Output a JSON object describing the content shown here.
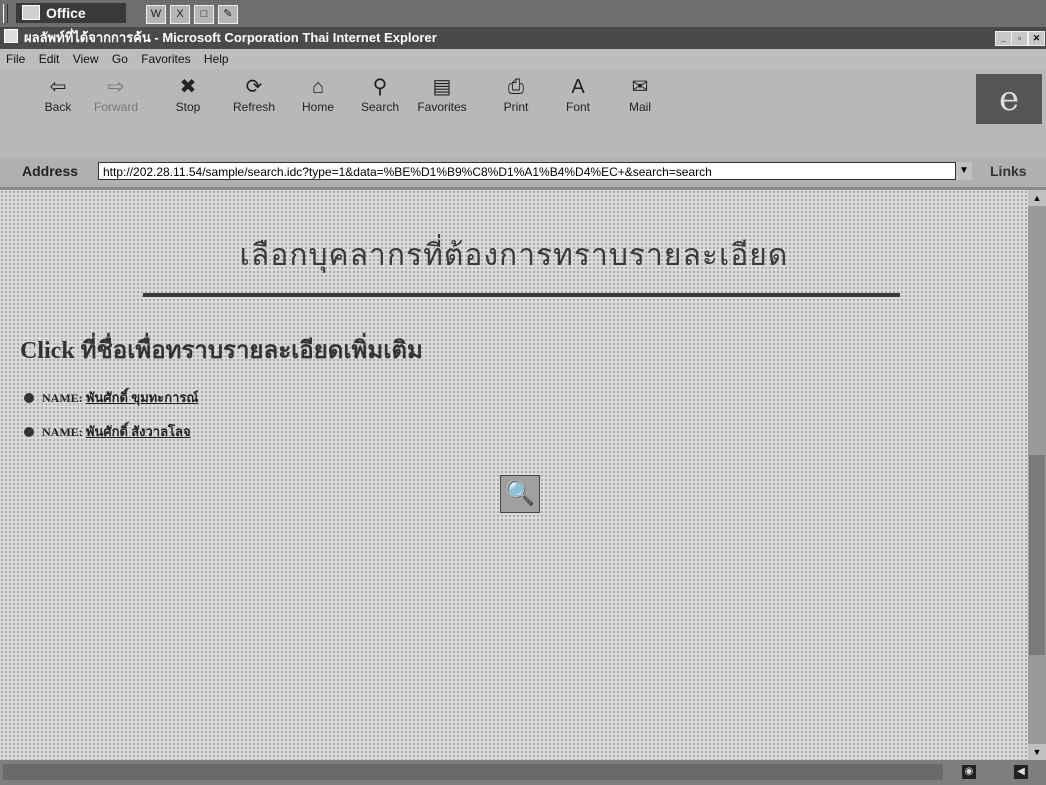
{
  "office_bar": {
    "label": "Office",
    "apps": [
      {
        "icon": "word-icon",
        "glyph": "W"
      },
      {
        "icon": "excel-icon",
        "glyph": "X"
      },
      {
        "icon": "powerpoint-icon",
        "glyph": "□"
      },
      {
        "icon": "access-icon",
        "glyph": "✎"
      }
    ]
  },
  "window": {
    "title": "ผลลัพท์ที่ได้จากการค้น - Microsoft Corporation Thai Internet Explorer"
  },
  "menu": [
    "File",
    "Edit",
    "View",
    "Go",
    "Favorites",
    "Help"
  ],
  "toolbar": {
    "buttons": [
      {
        "label": "Back",
        "icon": "back-arrow-icon",
        "glyph": "⇦"
      },
      {
        "label": "Forward",
        "icon": "forward-arrow-icon",
        "glyph": "⇨"
      },
      {
        "label": "Stop",
        "icon": "stop-icon",
        "glyph": "✖"
      },
      {
        "label": "Refresh",
        "icon": "refresh-icon",
        "glyph": "⟳"
      },
      {
        "label": "Home",
        "icon": "home-icon",
        "glyph": "⌂"
      },
      {
        "label": "Search",
        "icon": "search-icon",
        "glyph": "⚲"
      },
      {
        "label": "Favorites",
        "icon": "favorites-icon",
        "glyph": "▤"
      },
      {
        "label": "Print",
        "icon": "print-icon",
        "glyph": "⎙"
      },
      {
        "label": "Font",
        "icon": "font-icon",
        "glyph": "A"
      },
      {
        "label": "Mail",
        "icon": "mail-icon",
        "glyph": "✉"
      }
    ]
  },
  "address": {
    "label": "Address",
    "url": "http://202.28.11.54/sample/search.idc?type=1&data=%BE%D1%B9%C8%D1%A1%B4%D4%EC+&search=search",
    "links_label": "Links"
  },
  "page": {
    "title": "เลือกบุคลากรที่ต้องการทราบรายละเอียด",
    "subheading": "Click ที่ชื่อเพื่อทราบรายละเอียดเพิ่มเติม",
    "results": [
      {
        "label": "NAME:",
        "link": "พันศักดิ์ ขุมทะการณ์"
      },
      {
        "label": "NAME:",
        "link": "พันศักดิ์ สังวาลโลจ"
      }
    ]
  }
}
